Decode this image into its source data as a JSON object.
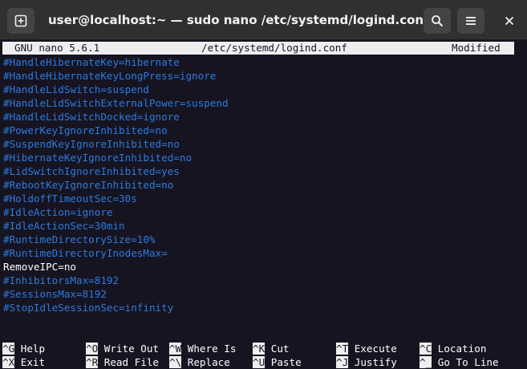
{
  "window": {
    "title": "user@localhost:~ — sudo nano /etc/systemd/logind.conf",
    "buttons": {
      "new_tab": "new-tab-icon",
      "search": "search-icon",
      "menu": "hamburger-menu-icon",
      "close": "close-icon"
    }
  },
  "colors": {
    "terminal_bg": "#171421",
    "comment": "#2a7bde",
    "text": "#ffffff",
    "bar_bg": "#eeeeee"
  },
  "nano": {
    "version": "GNU nano 5.6.1",
    "filename": "/etc/systemd/logind.conf",
    "state": "Modified"
  },
  "lines": [
    "#HandleHibernateKey=hibernate",
    "#HandleHibernateKeyLongPress=ignore",
    "#HandleLidSwitch=suspend",
    "#HandleLidSwitchExternalPower=suspend",
    "#HandleLidSwitchDocked=ignore",
    "#PowerKeyIgnoreInhibited=no",
    "#SuspendKeyIgnoreInhibited=no",
    "#HibernateKeyIgnoreInhibited=no",
    "#LidSwitchIgnoreInhibited=yes",
    "#RebootKeyIgnoreInhibited=no",
    "#HoldoffTimeoutSec=30s",
    "#IdleAction=ignore",
    "#IdleActionSec=30min",
    "#RuntimeDirectorySize=10%",
    "#RuntimeDirectoryInodesMax=",
    "RemoveIPC=no",
    "#InhibitorsMax=8192",
    "#SessionsMax=8192",
    "#StopIdleSessionSec=infinity"
  ],
  "shortcuts": [
    {
      "key": "^G",
      "label": "Help"
    },
    {
      "key": "^O",
      "label": "Write Out"
    },
    {
      "key": "^W",
      "label": "Where Is"
    },
    {
      "key": "^K",
      "label": "Cut"
    },
    {
      "key": "^T",
      "label": "Execute"
    },
    {
      "key": "^C",
      "label": "Location"
    },
    {
      "key": "^X",
      "label": "Exit"
    },
    {
      "key": "^R",
      "label": "Read File"
    },
    {
      "key": "^\\",
      "label": "Replace"
    },
    {
      "key": "^U",
      "label": "Paste"
    },
    {
      "key": "^J",
      "label": "Justify"
    },
    {
      "key": "^_",
      "label": "Go To Line"
    }
  ]
}
